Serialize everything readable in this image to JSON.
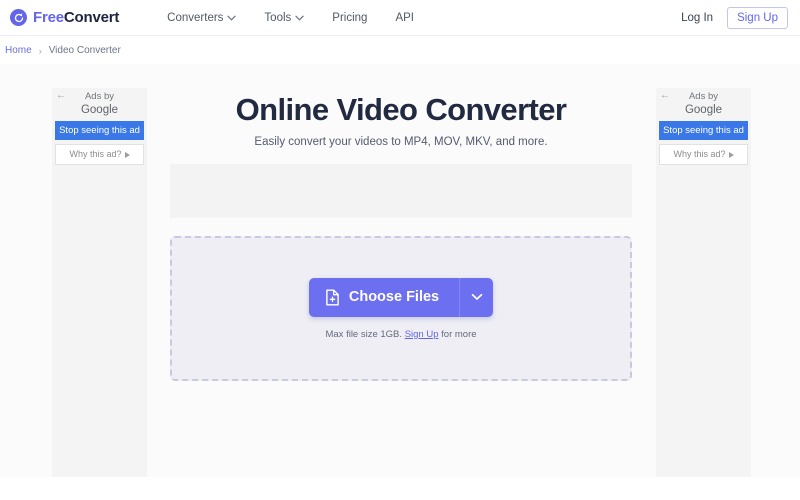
{
  "header": {
    "logo": {
      "icon": "refresh-circle-icon",
      "text_primary": "Free",
      "text_secondary": "Convert"
    },
    "nav": [
      {
        "label": "Converters",
        "has_caret": true
      },
      {
        "label": "Tools",
        "has_caret": true
      },
      {
        "label": "Pricing",
        "has_caret": false
      },
      {
        "label": "API",
        "has_caret": false
      }
    ],
    "login_label": "Log In",
    "signup_label": "Sign Up"
  },
  "breadcrumb": {
    "home_label": "Home",
    "separator": "›",
    "current_label": "Video Converter"
  },
  "main": {
    "title": "Online Video Converter",
    "subtitle": "Easily convert your videos to MP4, MOV, MKV, and more.",
    "choose_files_label": "Choose Files",
    "choose_files_icon": "file-plus-icon",
    "caret_icon": "chevron-down-icon",
    "max_note_prefix": "Max file size 1GB.",
    "max_note_link": "Sign Up",
    "max_note_suffix": "for more"
  },
  "ads": {
    "left": {
      "back_icon": "←",
      "ads_line": "Ads by",
      "google_line": "Google",
      "stop_label": "Stop seeing this ad",
      "why_label": "Why this ad?"
    },
    "right": {
      "back_icon": "←",
      "ads_line": "Ads by",
      "google_line": "Google",
      "stop_label": "Stop seeing this ad",
      "why_label": "Why this ad?"
    }
  },
  "colors": {
    "brand_purple": "#6366e8",
    "button_purple": "#6b6ff0",
    "title_navy": "#222a42",
    "google_blue": "#3b78e7",
    "dropzone_fill": "#eeeef4",
    "dropzone_border": "#c9cade"
  }
}
